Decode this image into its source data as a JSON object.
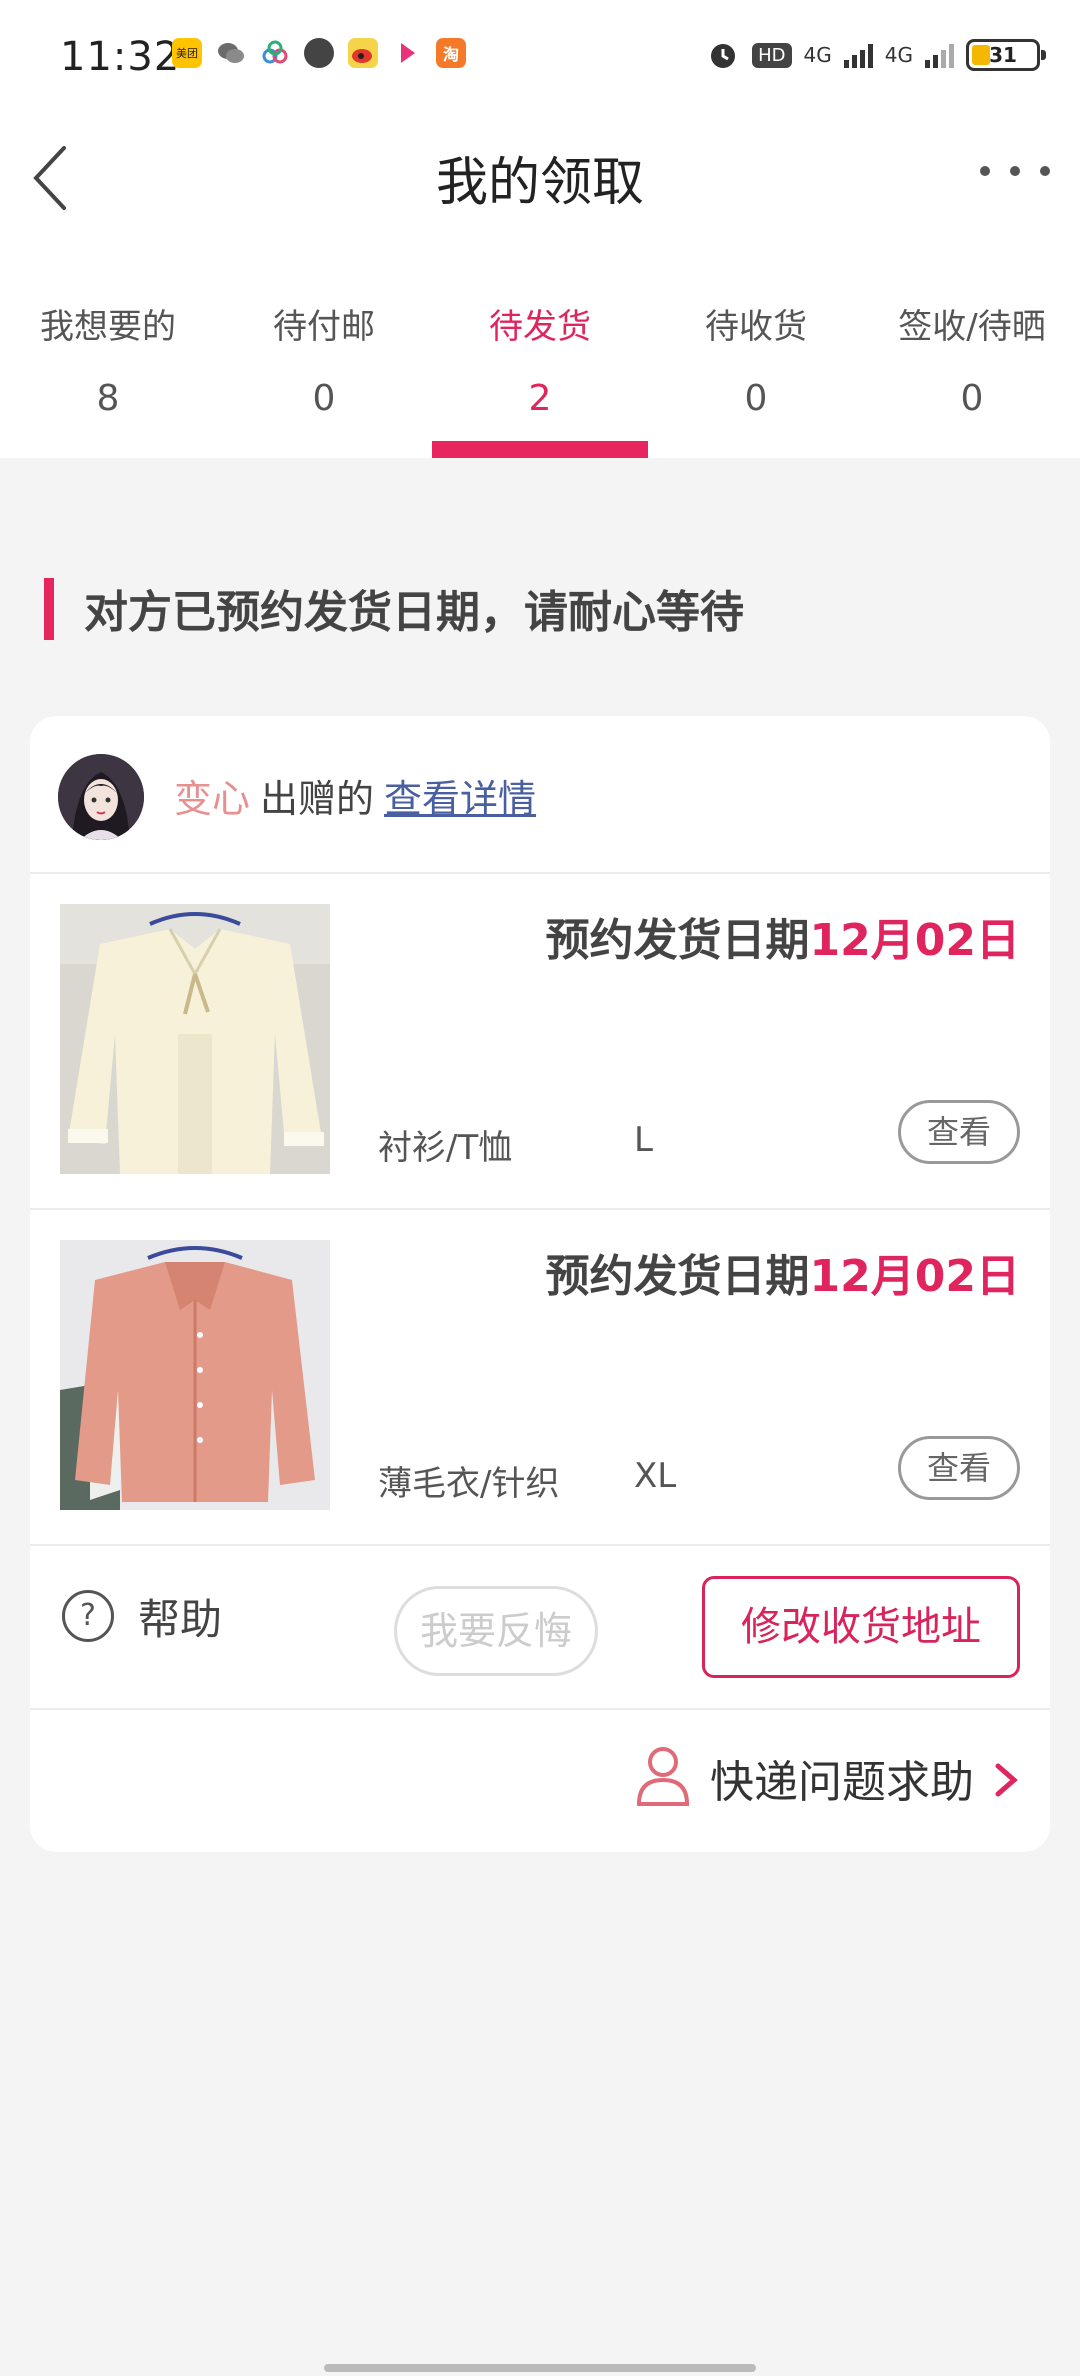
{
  "status_bar": {
    "time": "11:32",
    "app_icons": [
      {
        "name": "meituan-icon",
        "label": "美团",
        "color": "#ffc300"
      },
      {
        "name": "wechat-icon",
        "label": "",
        "color": "#6b6b6b"
      },
      {
        "name": "cloud-app-icon",
        "label": "",
        "color": "#3b8fd9"
      },
      {
        "name": "compass-app-icon",
        "label": "",
        "color": "#444444"
      },
      {
        "name": "weibo-icon",
        "label": "",
        "color": "#f2a43a"
      },
      {
        "name": "video-app-icon",
        "label": "",
        "color": "#e8327a"
      },
      {
        "name": "taobao-icon",
        "label": "淘",
        "color": "#f47a2a"
      }
    ],
    "hd_label": "HD",
    "network_1": "4G",
    "network_2": "4G",
    "battery": "31"
  },
  "header": {
    "title": "我的领取"
  },
  "tabs": [
    {
      "label": "我想要的",
      "count": "8"
    },
    {
      "label": "待付邮",
      "count": "0"
    },
    {
      "label": "待发货",
      "count": "2"
    },
    {
      "label": "待收货",
      "count": "0"
    },
    {
      "label": "签收/待晒",
      "count": "0"
    }
  ],
  "active_tab_index": 2,
  "notice": "对方已预约发货日期，请耐心等待",
  "order": {
    "sender_name": "变心",
    "sender_verb": "出赠的",
    "detail_link": "查看详情",
    "items": [
      {
        "ship_label": "预约发货日期",
        "ship_date": "12月02日",
        "category": "衬衫/T恤",
        "size": "L",
        "view_label": "查看"
      },
      {
        "ship_label": "预约发货日期",
        "ship_date": "12月02日",
        "category": "薄毛衣/针织",
        "size": "XL",
        "view_label": "查看"
      }
    ],
    "help_label": "帮助",
    "regret_label": "我要反悔",
    "change_address_label": "修改收货地址",
    "express_help_label": "快递问题求助"
  },
  "colors": {
    "accent": "#e0245e",
    "sender_name": "#e88f8f",
    "link": "#4a5fa0",
    "background": "#f4f4f4"
  }
}
